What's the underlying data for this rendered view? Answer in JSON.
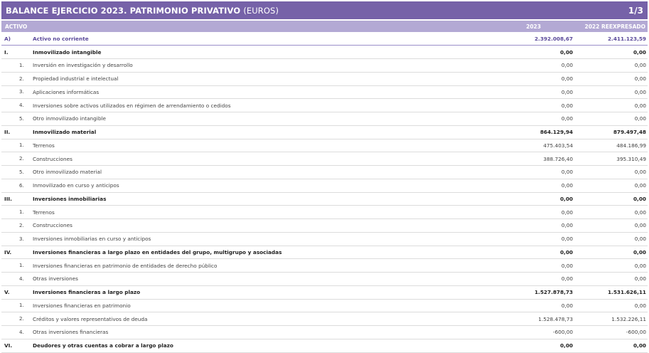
{
  "header": {
    "title": "BALANCE EJERCICIO 2023. PATRIMONIO PRIVATIVO",
    "unit": "(EUROS)",
    "page": "1/3"
  },
  "columns": {
    "label": "ACTIVO",
    "y1": "2023",
    "y2": "2022 REEXPRESADO"
  },
  "rows": [
    {
      "kind": "main",
      "code": "A)",
      "label": "Activo no corriente",
      "v1": "2.392.008,67",
      "v2": "2.411.123,59"
    },
    {
      "kind": "group",
      "code": "I.",
      "label": "Inmovilizado intangible",
      "v1": "0,00",
      "v2": "0,00"
    },
    {
      "kind": "sub",
      "code": "1.",
      "label": "Inversión en investigación y desarrollo",
      "v1": "0,00",
      "v2": "0,00"
    },
    {
      "kind": "sub",
      "code": "2.",
      "label": "Propiedad industrial e intelectual",
      "v1": "0,00",
      "v2": "0,00"
    },
    {
      "kind": "sub",
      "code": "3.",
      "label": "Aplicaciones informáticas",
      "v1": "0,00",
      "v2": "0,00"
    },
    {
      "kind": "sub",
      "code": "4.",
      "label": "Inversiones sobre activos utilizados en régimen de arrendamiento o cedidos",
      "v1": "0,00",
      "v2": "0,00"
    },
    {
      "kind": "sub",
      "code": "5.",
      "label": "Otro inmovilizado intangible",
      "v1": "0,00",
      "v2": "0,00"
    },
    {
      "kind": "group",
      "code": "II.",
      "label": "Inmovilizado material",
      "v1": "864.129,94",
      "v2": "879.497,48"
    },
    {
      "kind": "sub",
      "code": "1.",
      "label": "Terrenos",
      "v1": "475.403,54",
      "v2": "484.186,99"
    },
    {
      "kind": "sub",
      "code": "2.",
      "label": "Construcciones",
      "v1": "388.726,40",
      "v2": "395.310,49"
    },
    {
      "kind": "sub",
      "code": "5.",
      "label": "Otro inmovilizado material",
      "v1": "0,00",
      "v2": "0,00"
    },
    {
      "kind": "sub",
      "code": "6.",
      "label": "Inmovilizado en curso y anticipos",
      "v1": "0,00",
      "v2": "0,00"
    },
    {
      "kind": "group",
      "code": "III.",
      "label": "Inversiones inmobiliarias",
      "v1": "0,00",
      "v2": "0,00"
    },
    {
      "kind": "sub",
      "code": "1.",
      "label": "Terrenos",
      "v1": "0,00",
      "v2": "0,00"
    },
    {
      "kind": "sub",
      "code": "2.",
      "label": "Construcciones",
      "v1": "0,00",
      "v2": "0,00"
    },
    {
      "kind": "sub",
      "code": "3.",
      "label": "Inversiones inmobiliarias en curso y anticipos",
      "v1": "0,00",
      "v2": "0,00"
    },
    {
      "kind": "group",
      "code": "IV.",
      "label": "Inversiones financieras a largo plazo en entidades del grupo, multigrupo y asociadas",
      "v1": "0,00",
      "v2": "0,00"
    },
    {
      "kind": "sub",
      "code": "1.",
      "label": "Inversiones financieras en patrimonio de entidades de derecho público",
      "v1": "0,00",
      "v2": "0,00"
    },
    {
      "kind": "sub",
      "code": "4.",
      "label": "Otras inversiones",
      "v1": "0,00",
      "v2": "0,00"
    },
    {
      "kind": "group",
      "code": "V.",
      "label": "Inversiones financieras a largo plazo",
      "v1": "1.527.878,73",
      "v2": "1.531.626,11"
    },
    {
      "kind": "sub",
      "code": "1.",
      "label": "Inversiones financieras en patrimonio",
      "v1": "0,00",
      "v2": "0,00"
    },
    {
      "kind": "sub",
      "code": "2.",
      "label": "Créditos y valores representativos de deuda",
      "v1": "1.528.478,73",
      "v2": "1.532.226,11"
    },
    {
      "kind": "sub",
      "code": "4.",
      "label": "Otras inversiones financieras",
      "v1": "-600,00",
      "v2": "-600,00"
    },
    {
      "kind": "group",
      "code": "VI.",
      "label": "Deudores y otras cuentas a cobrar a largo plazo",
      "v1": "0,00",
      "v2": "0,00"
    }
  ]
}
